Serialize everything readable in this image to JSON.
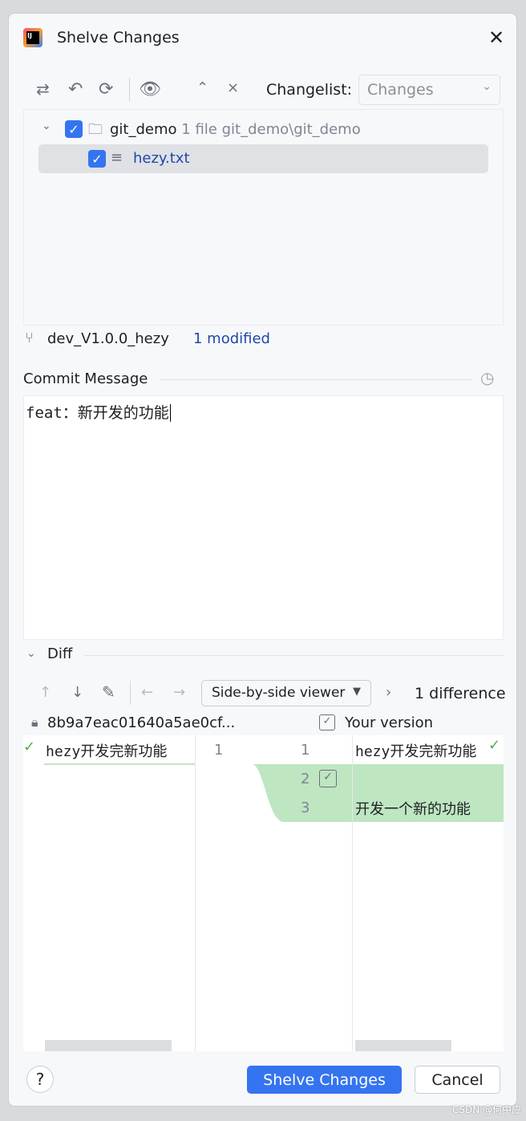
{
  "title": "Shelve Changes",
  "toolbar": {
    "changelist_label": "Changelist:",
    "changelist_value": "Changes"
  },
  "tree": {
    "root": {
      "name": "git_demo",
      "count": "1 file",
      "path": "git_demo\\git_demo"
    },
    "file": "hezy.txt"
  },
  "branch": {
    "name": "dev_V1.0.0_hezy",
    "status": "1 modified"
  },
  "commit": {
    "label": "Commit Message",
    "text": "feat：新开发的功能"
  },
  "diff": {
    "label": "Diff",
    "viewer": "Side-by-side viewer",
    "count": "1 difference",
    "left_rev": "8b9a7eac01640a5ae0cf...",
    "right_label": "Your version",
    "left_lines": [
      "hezy开发完新功能"
    ],
    "left_nums": [
      "1"
    ],
    "right_nums": [
      "1",
      "2",
      "3"
    ],
    "right_lines": [
      "hezy开发完新功能",
      "",
      "开发一个新的功能"
    ]
  },
  "buttons": {
    "shelve": "Shelve Changes",
    "cancel": "Cancel",
    "help": "?"
  },
  "accent": "#3574f0",
  "diff_added": "#bee6c1",
  "watermark": "CSDN @何中应"
}
